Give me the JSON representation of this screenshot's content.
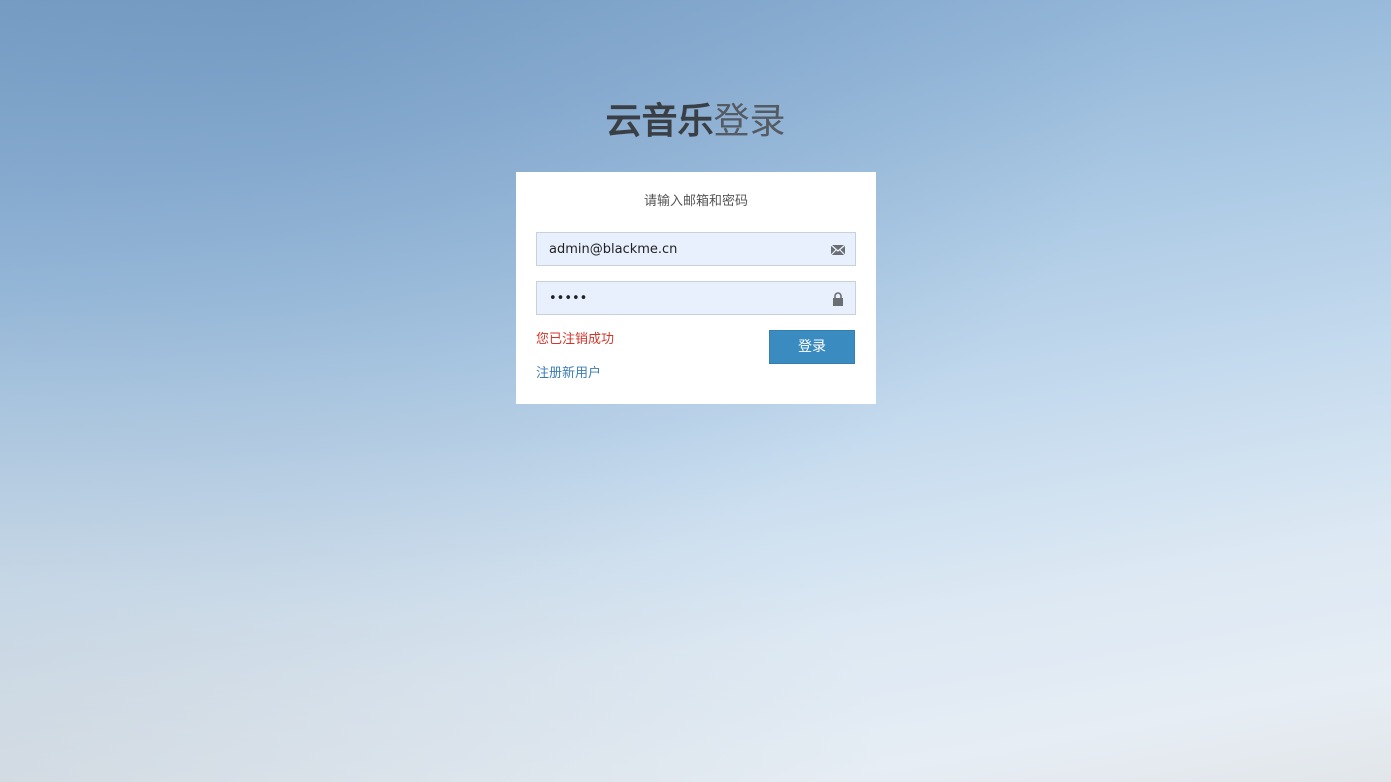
{
  "page": {
    "title_brand": "云音乐",
    "title_action": "登录"
  },
  "login_form": {
    "hint": "请输入邮箱和密码",
    "email": {
      "value": "admin@blackme.cn",
      "icon": "envelope-icon"
    },
    "password": {
      "value": "•••••",
      "icon": "lock-icon"
    },
    "status_message": "您已注销成功",
    "submit_label": "登录",
    "register_link": "注册新用户"
  },
  "colors": {
    "accent": "#3a8bc0",
    "error": "#d0352a",
    "link": "#3a7db5",
    "input_bg": "#e8f0fe"
  }
}
